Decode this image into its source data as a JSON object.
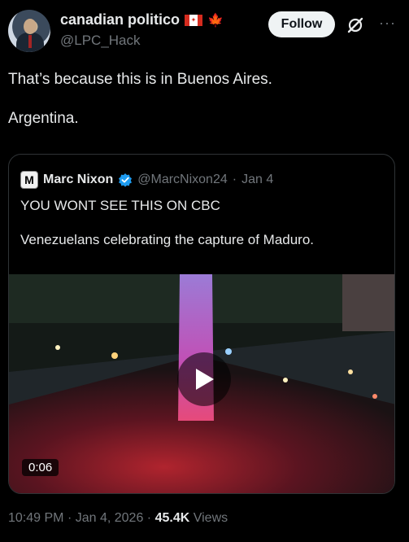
{
  "author": {
    "display_name": "canadian politico",
    "handle": "@LPC_Hack",
    "flag_colors": [
      "#d52b1e",
      "#ffffff",
      "#d52b1e"
    ],
    "maple_leaf": "🍁"
  },
  "actions": {
    "follow_label": "Follow",
    "grok_icon": "grok-icon",
    "more_label": "···"
  },
  "tweet": {
    "line1": "That’s because this is in Buenos Aires.",
    "line2": "Argentina."
  },
  "quote": {
    "avatar_letter": "M",
    "name": "Marc Nixon",
    "handle": "@MarcNixon24",
    "separator": "·",
    "date": "Jan 4",
    "line1": "YOU WONT SEE THIS ON CBC",
    "line2": "Venezuelans celebrating the capture of Maduro."
  },
  "video": {
    "duration": "0:06"
  },
  "footer": {
    "time": "10:49 PM",
    "sep1": "·",
    "date": "Jan 4, 2026",
    "sep2": "·",
    "views_count": "45.4K",
    "views_label": "Views"
  },
  "colors": {
    "accent_blue": "#1d9bf0",
    "muted": "#71767b",
    "text": "#e7e9ea",
    "background": "#000000"
  }
}
